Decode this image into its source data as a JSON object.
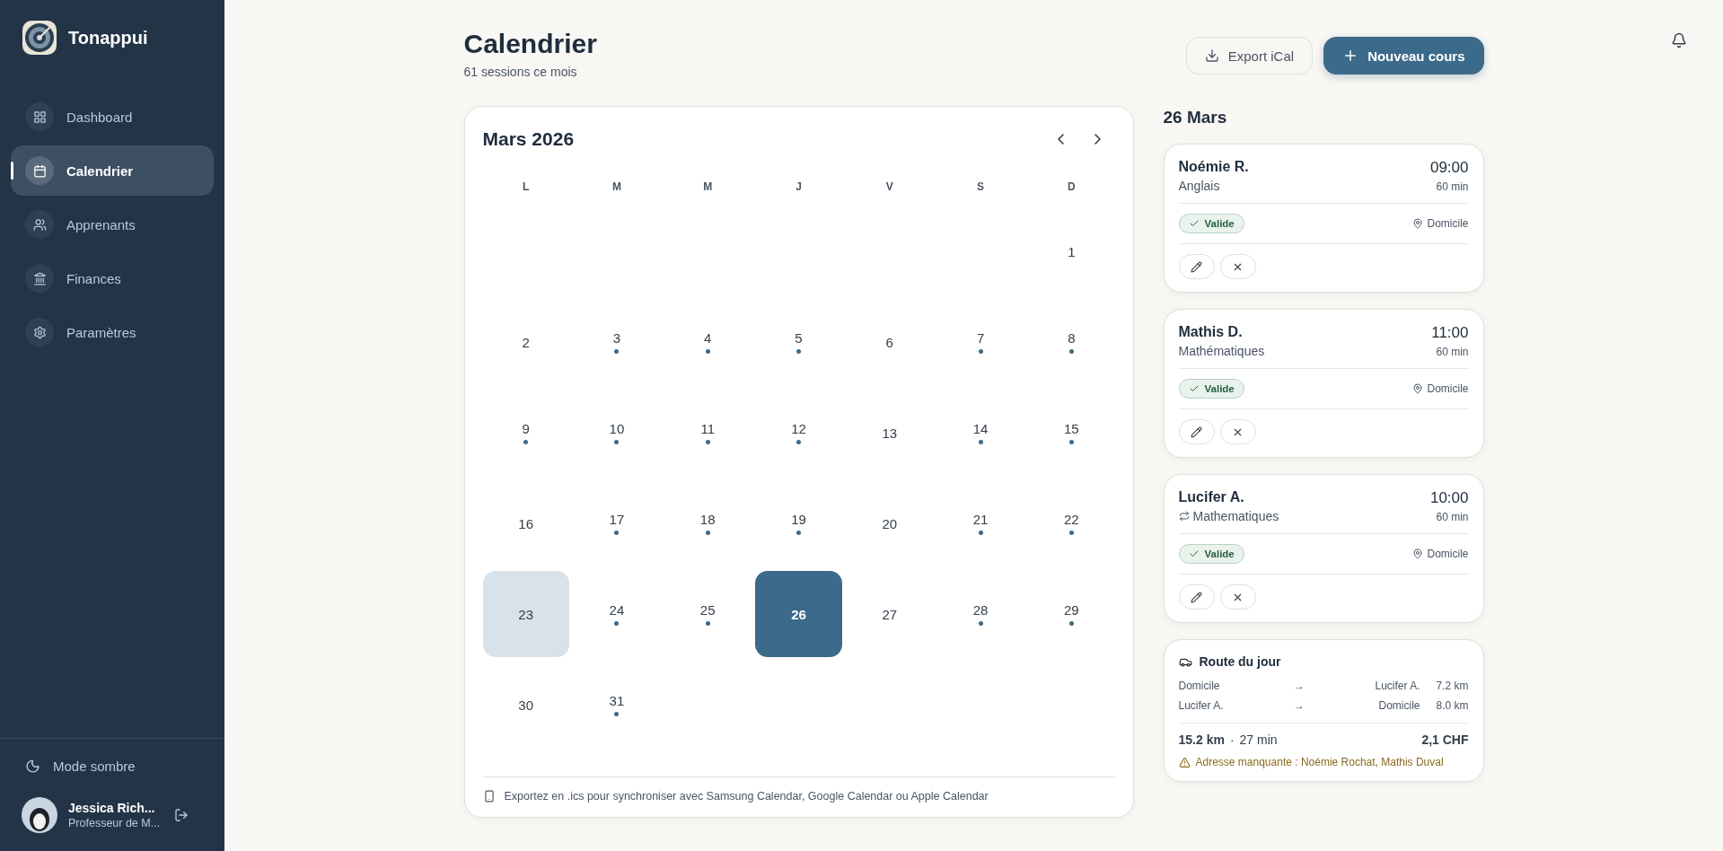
{
  "brand": {
    "name": "Tonappui"
  },
  "sidebar": {
    "items": [
      {
        "label": "Dashboard",
        "selected": false
      },
      {
        "label": "Calendrier",
        "selected": true
      },
      {
        "label": "Apprenants",
        "selected": false
      },
      {
        "label": "Finances",
        "selected": false
      },
      {
        "label": "Paramètres",
        "selected": false
      }
    ],
    "dark_mode": "Mode sombre",
    "user": {
      "name": "Jessica Rich...",
      "role": "Professeur de M..."
    }
  },
  "header": {
    "title": "Calendrier",
    "subtitle": "61 sessions ce mois",
    "buttons": [
      {
        "label": "Export iCal",
        "kind": "export"
      },
      {
        "label": "Nouveau cours",
        "kind": "primary"
      }
    ]
  },
  "calendar": {
    "month": "Mars 2026",
    "weekdays": [
      "L",
      "M",
      "M",
      "J",
      "V",
      "S",
      "D"
    ],
    "weeks": [
      {
        "kind": "first",
        "days": [
          {
            "day": "1",
            "session": false,
            "today": false,
            "selected": false
          }
        ]
      },
      {
        "kind": "full",
        "days": [
          {
            "day": "2",
            "session": false,
            "today": false,
            "selected": false
          },
          {
            "day": "3",
            "session": true,
            "today": false,
            "selected": false
          },
          {
            "day": "4",
            "session": true,
            "today": false,
            "selected": false
          },
          {
            "day": "5",
            "session": true,
            "today": false,
            "selected": false
          },
          {
            "day": "6",
            "session": false,
            "today": false,
            "selected": false
          },
          {
            "day": "7",
            "session": true,
            "today": false,
            "selected": false
          },
          {
            "day": "8",
            "session": true,
            "today": false,
            "selected": false
          }
        ]
      },
      {
        "kind": "full",
        "days": [
          {
            "day": "9",
            "session": true,
            "today": false,
            "selected": false
          },
          {
            "day": "10",
            "session": true,
            "today": false,
            "selected": false
          },
          {
            "day": "11",
            "session": true,
            "today": false,
            "selected": false
          },
          {
            "day": "12",
            "session": true,
            "today": false,
            "selected": false
          },
          {
            "day": "13",
            "session": false,
            "today": false,
            "selected": false
          },
          {
            "day": "14",
            "session": true,
            "today": false,
            "selected": false
          },
          {
            "day": "15",
            "session": true,
            "today": false,
            "selected": false
          }
        ]
      },
      {
        "kind": "full",
        "days": [
          {
            "day": "16",
            "session": false,
            "today": false,
            "selected": false
          },
          {
            "day": "17",
            "session": true,
            "today": false,
            "selected": false
          },
          {
            "day": "18",
            "session": true,
            "today": false,
            "selected": false
          },
          {
            "day": "19",
            "session": true,
            "today": false,
            "selected": false
          },
          {
            "day": "20",
            "session": false,
            "today": false,
            "selected": false
          },
          {
            "day": "21",
            "session": true,
            "today": false,
            "selected": false
          },
          {
            "day": "22",
            "session": true,
            "today": false,
            "selected": false
          }
        ]
      },
      {
        "kind": "full",
        "days": [
          {
            "day": "23",
            "session": false,
            "today": true,
            "selected": false
          },
          {
            "day": "24",
            "session": true,
            "today": false,
            "selected": false
          },
          {
            "day": "25",
            "session": true,
            "today": false,
            "selected": false
          },
          {
            "day": "26",
            "session": false,
            "today": false,
            "selected": true
          },
          {
            "day": "27",
            "session": false,
            "today": false,
            "selected": false
          },
          {
            "day": "28",
            "session": true,
            "today": false,
            "selected": false
          },
          {
            "day": "29",
            "session": true,
            "today": false,
            "selected": false
          }
        ]
      },
      {
        "kind": "last",
        "days": [
          {
            "day": "30",
            "session": false,
            "today": false,
            "selected": false
          },
          {
            "day": "31",
            "session": true,
            "today": false,
            "selected": false
          }
        ]
      }
    ],
    "footer": "Exportez en .ics pour synchroniser avec Samsung Calendar, Google Calendar ou Apple Calendar"
  },
  "day_panel": {
    "title": "26 Mars",
    "sessions": [
      {
        "name": "Noémie R.",
        "subject": "Anglais",
        "recurring": false,
        "time": "09:00",
        "duration": "60 min",
        "status": "Valide",
        "location": "Domicile"
      },
      {
        "name": "Mathis D.",
        "subject": "Mathématiques",
        "recurring": false,
        "time": "11:00",
        "duration": "60 min",
        "status": "Valide",
        "location": "Domicile"
      },
      {
        "name": "Lucifer A.",
        "subject": "Mathematiques",
        "recurring": true,
        "time": "10:00",
        "duration": "60 min",
        "status": "Valide",
        "location": "Domicile"
      }
    ],
    "route": {
      "title": "Route du jour",
      "legs": [
        {
          "from": "Domicile",
          "arrow": "→",
          "to": "Lucifer A.",
          "distance": "7.2 km"
        },
        {
          "from": "Lucifer A.",
          "arrow": "→",
          "to": "Domicile",
          "distance": "8.0 km"
        }
      ],
      "total_distance": "15.2 km",
      "separator": "·",
      "total_time": "27 min",
      "cost": "2,1 CHF",
      "warning": "Adresse manquante : Noémie Rochat, Mathis Duval"
    }
  }
}
